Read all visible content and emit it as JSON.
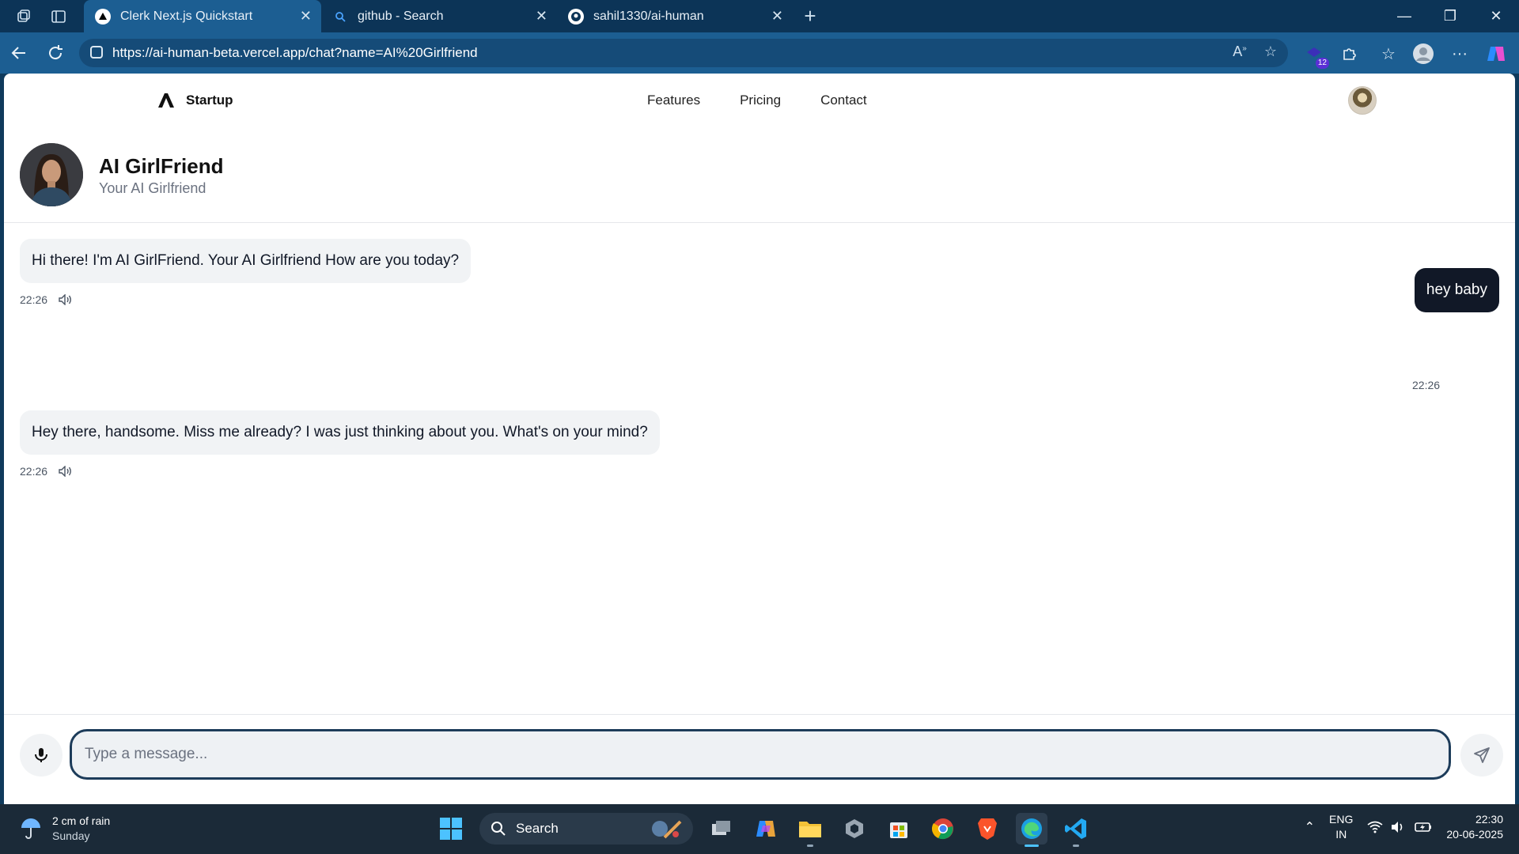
{
  "browser": {
    "tabs": [
      {
        "title": "Clerk Next.js Quickstart",
        "active": true
      },
      {
        "title": "github - Search",
        "active": false
      },
      {
        "title": "sahil1330/ai-human",
        "active": false
      }
    ],
    "url": "https://ai-human-beta.vercel.app/chat?name=AI%20Girlfriend",
    "extension_badge": "12"
  },
  "site": {
    "brand": "Startup",
    "menu": [
      "Features",
      "Pricing",
      "Contact"
    ]
  },
  "chat": {
    "bot_name": "AI GirlFriend",
    "bot_subtitle": "Your AI Girlfriend",
    "messages": [
      {
        "from": "bot",
        "text": "Hi there! I'm AI GirlFriend. Your AI Girlfriend How are you today?",
        "time": "22:26"
      },
      {
        "from": "user",
        "text": "hey baby",
        "time": "22:26"
      },
      {
        "from": "bot",
        "text": "Hey there, handsome. Miss me already? I was just thinking about you. What's on your mind?",
        "time": "22:26"
      }
    ],
    "input_placeholder": "Type a message..."
  },
  "taskbar": {
    "weather_line1": "2 cm of rain",
    "weather_line2": "Sunday",
    "search_label": "Search",
    "lang_line1": "ENG",
    "lang_line2": "IN",
    "time": "22:30",
    "date": "20-06-2025"
  },
  "colors": {
    "tabbar": "#0c3457",
    "active_tab": "#1c5e92",
    "user_bubble": "#111827",
    "bot_bubble": "#f1f3f5"
  }
}
